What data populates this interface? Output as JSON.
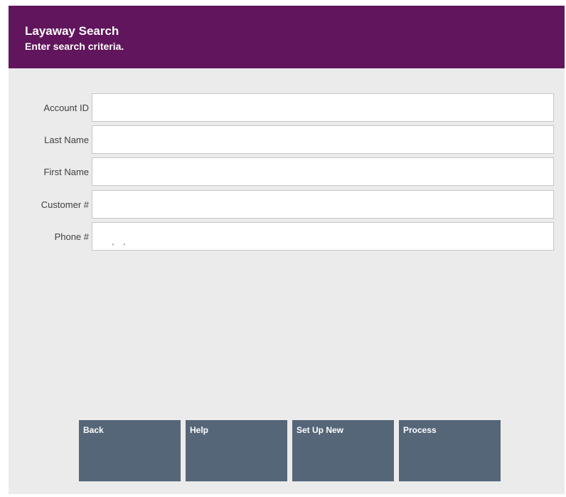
{
  "header": {
    "title": "Layaway Search",
    "subtitle": "Enter search criteria."
  },
  "form": {
    "fields": [
      {
        "label": "Account ID",
        "value": ""
      },
      {
        "label": "Last Name",
        "value": ""
      },
      {
        "label": "First Name",
        "value": ""
      },
      {
        "label": "Customer #",
        "value": ""
      },
      {
        "label": "Phone #",
        "value": "",
        "mask": ". ."
      }
    ]
  },
  "buttons": {
    "back": "Back",
    "help": "Help",
    "set_up_new": "Set Up New",
    "process": "Process"
  },
  "colors": {
    "header_bg": "#60155c",
    "button_bg": "#556679",
    "panel_bg": "#ebebeb"
  }
}
